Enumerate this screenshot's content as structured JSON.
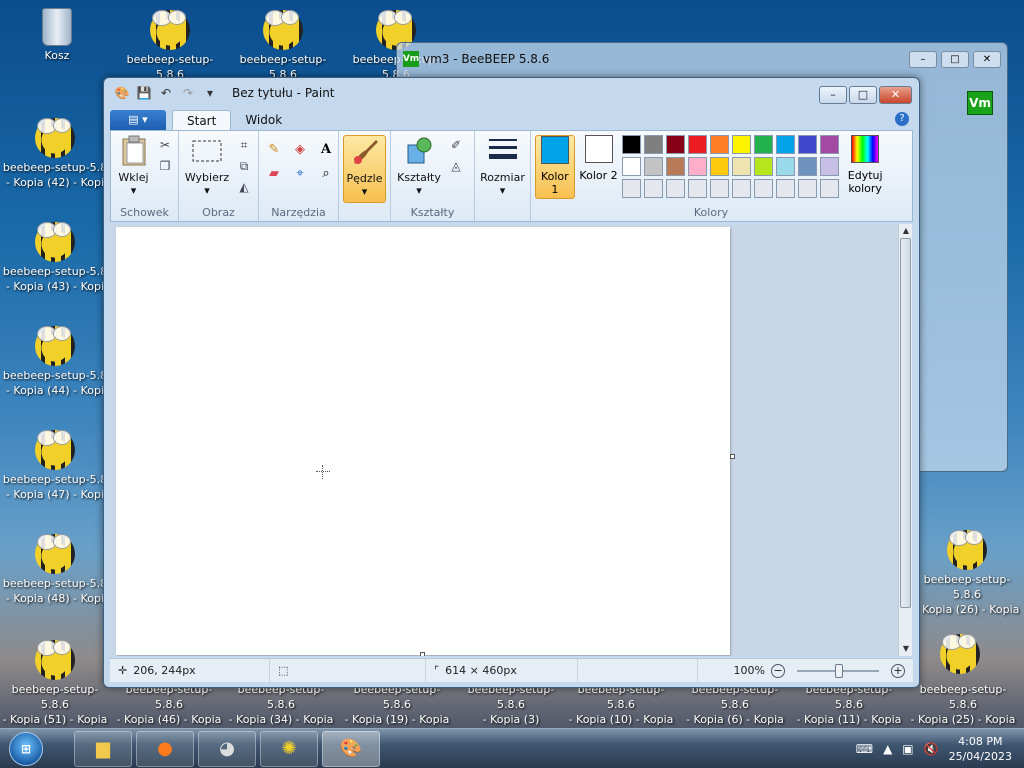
{
  "desktop": {
    "recycle_bin": "Kosz",
    "top_row": [
      "beebeep-setup-5.8.6",
      "beebeep-setup-5.8.6",
      "beebeep-setup-5.8.6"
    ],
    "left_column": [
      {
        "line1": "beebeep-setup-5.8",
        "line2": "- Kopia (42) - Kopi"
      },
      {
        "line1": "beebeep-setup-5.8",
        "line2": "- Kopia (43) - Kopi"
      },
      {
        "line1": "beebeep-setup-5.8",
        "line2": "- Kopia (44) - Kopi"
      },
      {
        "line1": "beebeep-setup-5.8",
        "line2": "- Kopia (47) - Kopi"
      },
      {
        "line1": "beebeep-setup-5.8",
        "line2": "- Kopia (48) - Kopi"
      }
    ],
    "bottom_row": [
      {
        "line1": "beebeep-setup-5.8.6",
        "line2": "- Kopia (51) - Kopia"
      },
      {
        "line1": "beebeep-setup-5.8.6",
        "line2": "- Kopia (46) - Kopia"
      },
      {
        "line1": "beebeep-setup-5.8.6",
        "line2": "- Kopia (34) - Kopia"
      },
      {
        "line1": "beebeep-setup-5.8.6",
        "line2": "- Kopia (19) - Kopia"
      },
      {
        "line1": "beebeep-setup-5.8.6",
        "line2": "- Kopia (3)"
      },
      {
        "line1": "beebeep-setup-5.8.6",
        "line2": "- Kopia (10) - Kopia"
      },
      {
        "line1": "beebeep-setup-5.8.6",
        "line2": "- Kopia (6) - Kopia"
      },
      {
        "line1": "beebeep-setup-5.8.6",
        "line2": "- Kopia (11) - Kopia"
      },
      {
        "line1": "beebeep-setup-5.8.6",
        "line2": "- Kopia (25) - Kopia"
      }
    ],
    "right_column": [
      {
        "line1": "beebeep-setup-5.8.6",
        "line2": "- Kopia (26) - Kopia"
      }
    ]
  },
  "beebeep_window": {
    "title": "vm3 - BeeBEEP 5.8.6",
    "logo": "Vm"
  },
  "paint": {
    "title": "Bez tytułu - Paint",
    "tabs": [
      "Start",
      "Widok"
    ],
    "groups": {
      "clipboard": {
        "label": "Schowek",
        "paste": "Wklej"
      },
      "image": {
        "label": "Obraz",
        "select": "Wybierz"
      },
      "tools": {
        "label": "Narzędzia"
      },
      "brushes": {
        "label": "Pędzle"
      },
      "shapes": {
        "label": "Kształty",
        "button": "Kształty"
      },
      "size": {
        "label": "Rozmiar"
      },
      "colors": {
        "label": "Kolory",
        "color1": "Kolor 1",
        "color2": "Kolor 2",
        "edit": "Edytuj kolory"
      }
    },
    "palette": [
      "#000000",
      "#7f7f7f",
      "#880015",
      "#ed1c24",
      "#ff7f27",
      "#fff200",
      "#22b14c",
      "#00a2e8",
      "#3f48cc",
      "#a349a4",
      "#ffffff",
      "#c3c3c3",
      "#b97a57",
      "#ffaec9",
      "#ffc90e",
      "#efe4b0",
      "#b5e61d",
      "#99d9ea",
      "#7092be",
      "#c8bfe7",
      "#e4e8ee",
      "#e4e8ee",
      "#e4e8ee",
      "#e4e8ee",
      "#e4e8ee",
      "#e4e8ee",
      "#e4e8ee",
      "#e4e8ee",
      "#e4e8ee",
      "#e4e8ee"
    ],
    "color1_value": "#00a2e8",
    "color2_value": "#ffffff",
    "status": {
      "cursor_pos": "206, 244px",
      "canvas_size": "614 × 460px",
      "zoom": "100%"
    }
  },
  "taskbar": {
    "time": "4:08 PM",
    "date": "25/04/2023"
  }
}
